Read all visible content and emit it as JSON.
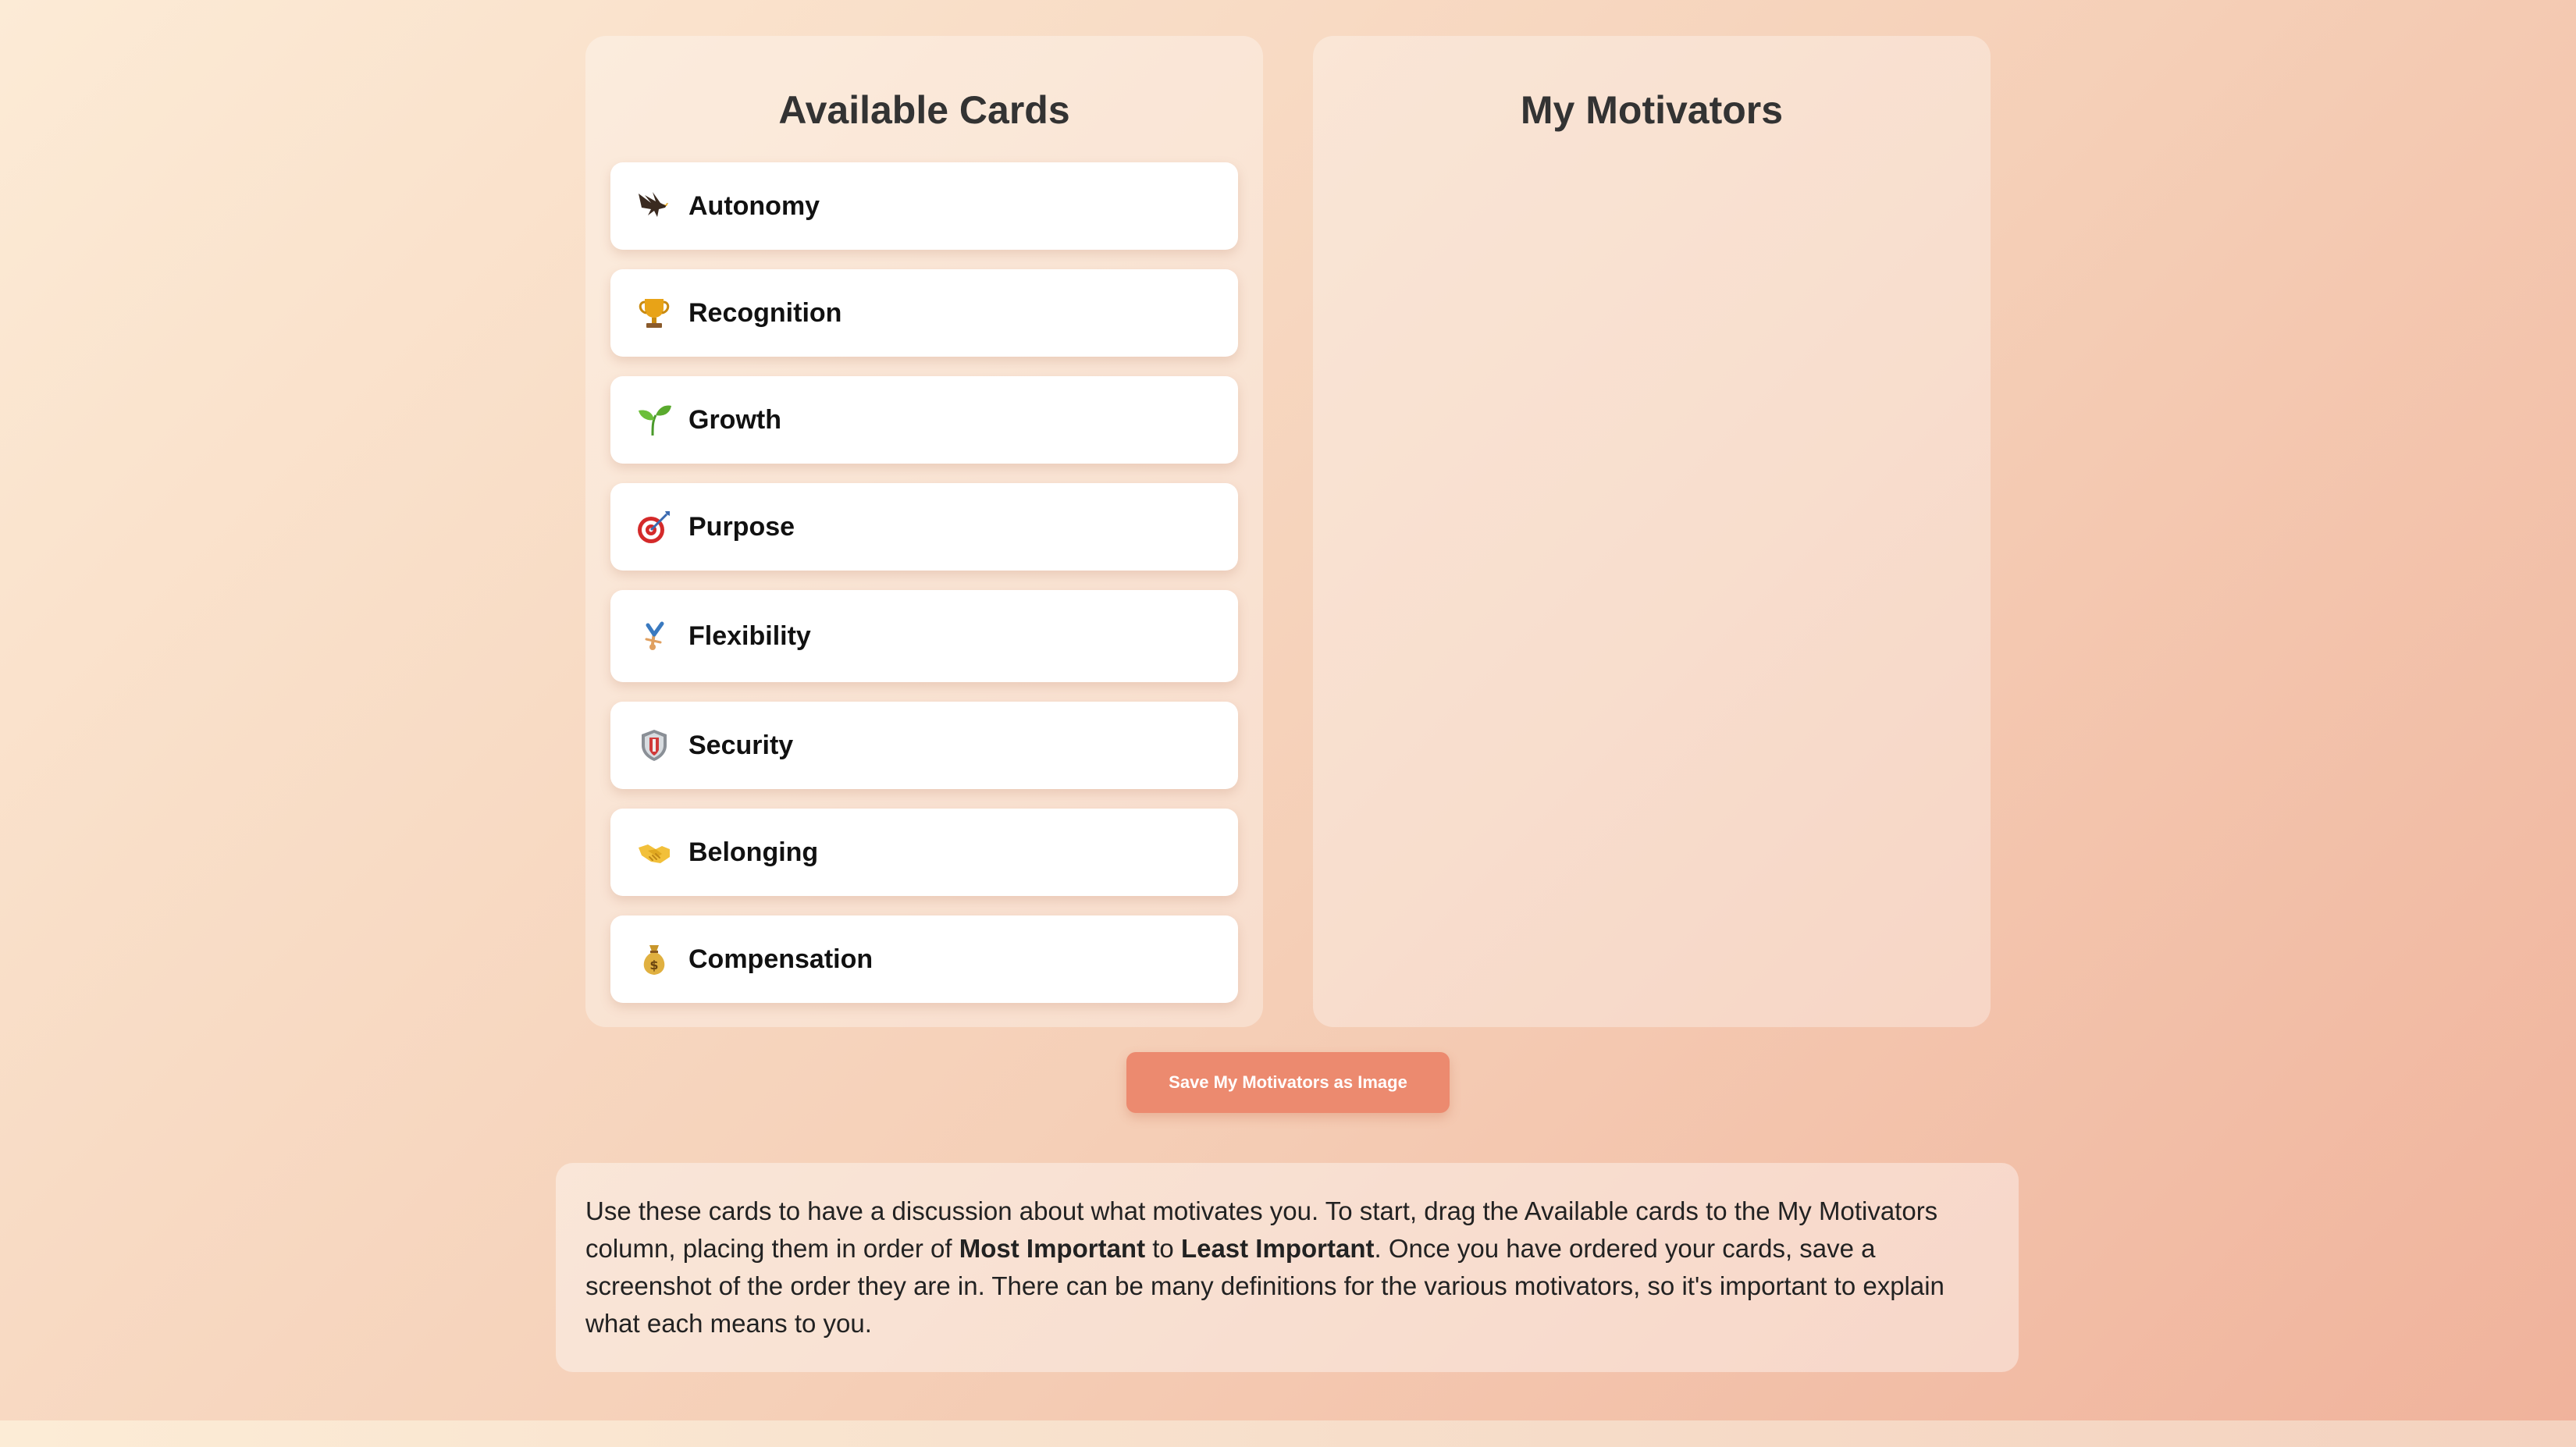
{
  "available_column": {
    "title": "Available Cards",
    "cards": [
      {
        "label": "Autonomy",
        "icon": "eagle-icon"
      },
      {
        "label": "Recognition",
        "icon": "trophy-icon"
      },
      {
        "label": "Growth",
        "icon": "seedling-icon"
      },
      {
        "label": "Purpose",
        "icon": "target-icon"
      },
      {
        "label": "Flexibility",
        "icon": "gymnast-icon"
      },
      {
        "label": "Security",
        "icon": "shield-icon"
      },
      {
        "label": "Belonging",
        "icon": "handshake-icon"
      },
      {
        "label": "Compensation",
        "icon": "money-bag-icon"
      }
    ]
  },
  "motivators_column": {
    "title": "My Motivators",
    "cards": []
  },
  "save_button": {
    "label": "Save My Motivators as Image",
    "color": "#ec8a6f"
  },
  "instructions": {
    "part1": "Use these cards to have a discussion about what motivates you. To start, drag the Available cards to the My Motivators column, placing them in order of ",
    "bold1": "Most Important",
    "part2": " to ",
    "bold2": "Least Important",
    "part3": ". Once you have ordered your cards, save a screenshot of the order they are in. There can be many definitions for the various motivators, so it's important to explain what each means to you."
  }
}
